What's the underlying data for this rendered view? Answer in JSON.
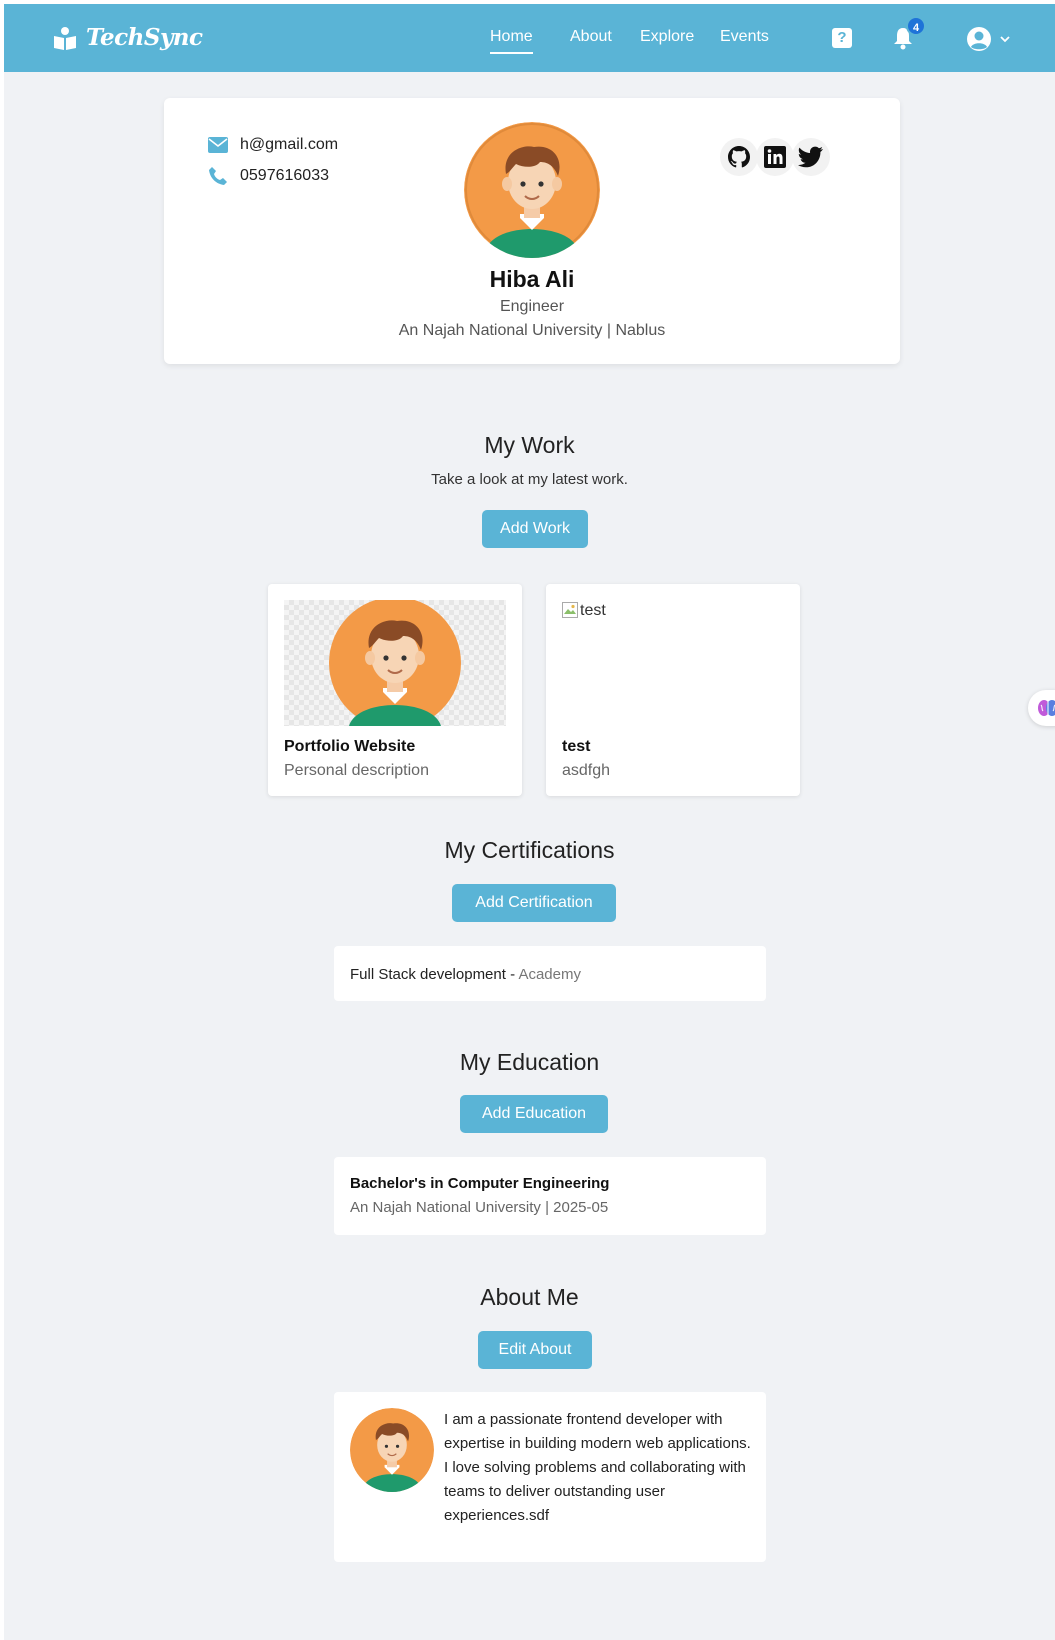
{
  "navbar": {
    "brand": "TechSync",
    "links": [
      {
        "label": "Home",
        "active": true
      },
      {
        "label": "About"
      },
      {
        "label": "Explore"
      },
      {
        "label": "Events"
      }
    ],
    "help_icon": "question-square-icon",
    "help_glyph": "?",
    "notification_count": "4",
    "bg_color": "#5ab4d6"
  },
  "profile": {
    "email": "h@gmail.com",
    "phone": "0597616033",
    "name": "Hiba Ali",
    "role": "Engineer",
    "organization": "An Najah National University | Nablus",
    "socials": [
      "github-icon",
      "linkedin-icon",
      "twitter-icon"
    ]
  },
  "work": {
    "title": "My Work",
    "subtitle": "Take a look at my latest work.",
    "add_label": "Add Work",
    "items": [
      {
        "title": "Portfolio Website",
        "description": "Personal description",
        "image": "avatar-illustration"
      },
      {
        "title": "test",
        "description": "asdfgh",
        "image_alt": "test"
      }
    ]
  },
  "certifications": {
    "title": "My Certifications",
    "add_label": "Add Certification",
    "items": [
      {
        "name": "Full Stack development",
        "separator": " - ",
        "issuer": "Academy"
      }
    ]
  },
  "education": {
    "title": "My Education",
    "add_label": "Add Education",
    "items": [
      {
        "degree": "Bachelor's in Computer Engineering",
        "meta": "An Najah National University | 2025-05"
      }
    ]
  },
  "about": {
    "title": "About Me",
    "edit_label": "Edit About",
    "text": "I am a passionate frontend developer with expertise in building modern web applications. I love solving problems and collaborating with teams to deliver outstanding user experiences.sdf"
  },
  "colors": {
    "accent": "#5ab4d6",
    "page_bg": "#f0f2f5",
    "avatar_orange": "#f39a47",
    "shirt_green": "#1f9a6c"
  }
}
